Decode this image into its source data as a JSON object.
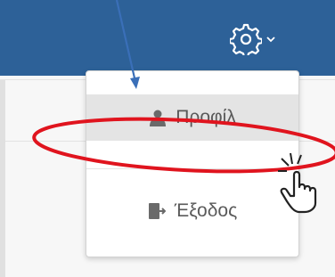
{
  "user_menu": {
    "gear_icon": "gear-icon",
    "chevron_icon": "chevron-down-icon",
    "items": [
      {
        "label": "Προφίλ",
        "icon": "user-icon"
      },
      {
        "label": "Έξοδος",
        "icon": "logout-icon"
      }
    ]
  },
  "colors": {
    "header": "#2d6198",
    "annotation_ellipse": "#e0141e",
    "annotation_arrow": "#3a6fb8"
  },
  "annotations": {
    "arrow": "arrow-annotation",
    "highlight": "red-ellipse-highlight",
    "cursor": "pointer-hand-cursor"
  }
}
